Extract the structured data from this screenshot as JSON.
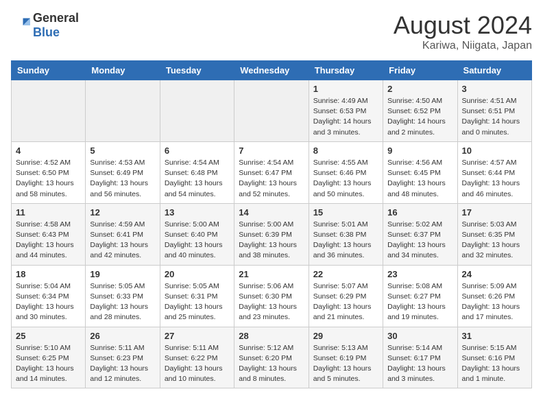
{
  "logo": {
    "general": "General",
    "blue": "Blue"
  },
  "title": "August 2024",
  "subtitle": "Kariwa, Niigata, Japan",
  "weekdays": [
    "Sunday",
    "Monday",
    "Tuesday",
    "Wednesday",
    "Thursday",
    "Friday",
    "Saturday"
  ],
  "weeks": [
    [
      {
        "day": "",
        "info": ""
      },
      {
        "day": "",
        "info": ""
      },
      {
        "day": "",
        "info": ""
      },
      {
        "day": "",
        "info": ""
      },
      {
        "day": "1",
        "info": "Sunrise: 4:49 AM\nSunset: 6:53 PM\nDaylight: 14 hours\nand 3 minutes."
      },
      {
        "day": "2",
        "info": "Sunrise: 4:50 AM\nSunset: 6:52 PM\nDaylight: 14 hours\nand 2 minutes."
      },
      {
        "day": "3",
        "info": "Sunrise: 4:51 AM\nSunset: 6:51 PM\nDaylight: 14 hours\nand 0 minutes."
      }
    ],
    [
      {
        "day": "4",
        "info": "Sunrise: 4:52 AM\nSunset: 6:50 PM\nDaylight: 13 hours\nand 58 minutes."
      },
      {
        "day": "5",
        "info": "Sunrise: 4:53 AM\nSunset: 6:49 PM\nDaylight: 13 hours\nand 56 minutes."
      },
      {
        "day": "6",
        "info": "Sunrise: 4:54 AM\nSunset: 6:48 PM\nDaylight: 13 hours\nand 54 minutes."
      },
      {
        "day": "7",
        "info": "Sunrise: 4:54 AM\nSunset: 6:47 PM\nDaylight: 13 hours\nand 52 minutes."
      },
      {
        "day": "8",
        "info": "Sunrise: 4:55 AM\nSunset: 6:46 PM\nDaylight: 13 hours\nand 50 minutes."
      },
      {
        "day": "9",
        "info": "Sunrise: 4:56 AM\nSunset: 6:45 PM\nDaylight: 13 hours\nand 48 minutes."
      },
      {
        "day": "10",
        "info": "Sunrise: 4:57 AM\nSunset: 6:44 PM\nDaylight: 13 hours\nand 46 minutes."
      }
    ],
    [
      {
        "day": "11",
        "info": "Sunrise: 4:58 AM\nSunset: 6:43 PM\nDaylight: 13 hours\nand 44 minutes."
      },
      {
        "day": "12",
        "info": "Sunrise: 4:59 AM\nSunset: 6:41 PM\nDaylight: 13 hours\nand 42 minutes."
      },
      {
        "day": "13",
        "info": "Sunrise: 5:00 AM\nSunset: 6:40 PM\nDaylight: 13 hours\nand 40 minutes."
      },
      {
        "day": "14",
        "info": "Sunrise: 5:00 AM\nSunset: 6:39 PM\nDaylight: 13 hours\nand 38 minutes."
      },
      {
        "day": "15",
        "info": "Sunrise: 5:01 AM\nSunset: 6:38 PM\nDaylight: 13 hours\nand 36 minutes."
      },
      {
        "day": "16",
        "info": "Sunrise: 5:02 AM\nSunset: 6:37 PM\nDaylight: 13 hours\nand 34 minutes."
      },
      {
        "day": "17",
        "info": "Sunrise: 5:03 AM\nSunset: 6:35 PM\nDaylight: 13 hours\nand 32 minutes."
      }
    ],
    [
      {
        "day": "18",
        "info": "Sunrise: 5:04 AM\nSunset: 6:34 PM\nDaylight: 13 hours\nand 30 minutes."
      },
      {
        "day": "19",
        "info": "Sunrise: 5:05 AM\nSunset: 6:33 PM\nDaylight: 13 hours\nand 28 minutes."
      },
      {
        "day": "20",
        "info": "Sunrise: 5:05 AM\nSunset: 6:31 PM\nDaylight: 13 hours\nand 25 minutes."
      },
      {
        "day": "21",
        "info": "Sunrise: 5:06 AM\nSunset: 6:30 PM\nDaylight: 13 hours\nand 23 minutes."
      },
      {
        "day": "22",
        "info": "Sunrise: 5:07 AM\nSunset: 6:29 PM\nDaylight: 13 hours\nand 21 minutes."
      },
      {
        "day": "23",
        "info": "Sunrise: 5:08 AM\nSunset: 6:27 PM\nDaylight: 13 hours\nand 19 minutes."
      },
      {
        "day": "24",
        "info": "Sunrise: 5:09 AM\nSunset: 6:26 PM\nDaylight: 13 hours\nand 17 minutes."
      }
    ],
    [
      {
        "day": "25",
        "info": "Sunrise: 5:10 AM\nSunset: 6:25 PM\nDaylight: 13 hours\nand 14 minutes."
      },
      {
        "day": "26",
        "info": "Sunrise: 5:11 AM\nSunset: 6:23 PM\nDaylight: 13 hours\nand 12 minutes."
      },
      {
        "day": "27",
        "info": "Sunrise: 5:11 AM\nSunset: 6:22 PM\nDaylight: 13 hours\nand 10 minutes."
      },
      {
        "day": "28",
        "info": "Sunrise: 5:12 AM\nSunset: 6:20 PM\nDaylight: 13 hours\nand 8 minutes."
      },
      {
        "day": "29",
        "info": "Sunrise: 5:13 AM\nSunset: 6:19 PM\nDaylight: 13 hours\nand 5 minutes."
      },
      {
        "day": "30",
        "info": "Sunrise: 5:14 AM\nSunset: 6:17 PM\nDaylight: 13 hours\nand 3 minutes."
      },
      {
        "day": "31",
        "info": "Sunrise: 5:15 AM\nSunset: 6:16 PM\nDaylight: 13 hours\nand 1 minute."
      }
    ]
  ]
}
